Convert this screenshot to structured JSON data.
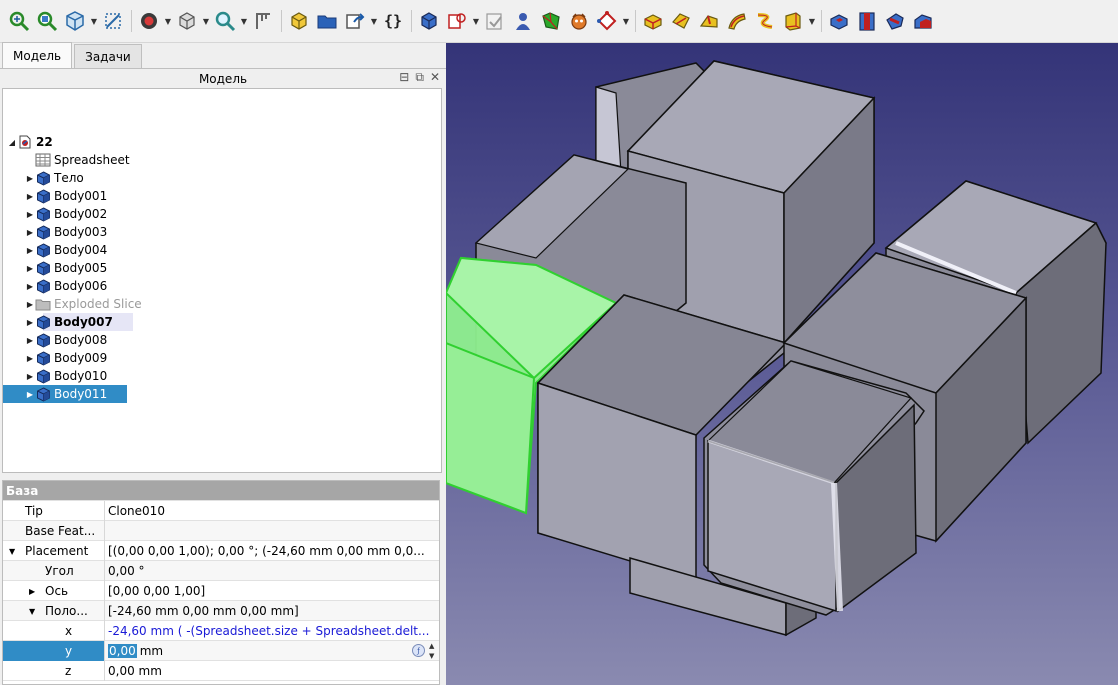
{
  "toolbar": {
    "icons": [
      "fit-all-icon",
      "zoom-selection-icon",
      "view-axonometric-icon",
      "view-measure-icon",
      "draw-style-icon",
      "bounding-box-icon",
      "view-zoom-icon",
      "measure-caliper-icon",
      "part-icon",
      "folder-icon",
      "link-icon",
      "macro-icon",
      "body-icon",
      "sketch-icon",
      "validate-sketch-icon",
      "map-sketch-icon",
      "face-icon",
      "creature-icon",
      "datum-plane-icon",
      "pad-icon",
      "revolution-icon",
      "additive-loft-icon",
      "additive-pipe-icon",
      "additive-helix-icon",
      "additive-box-icon",
      "pocket-icon",
      "hole-icon",
      "groove-icon",
      "subtractive-loft-icon"
    ],
    "brace_label": "{}"
  },
  "tabs": [
    {
      "label": "Модель",
      "active": true
    },
    {
      "label": "Задачи",
      "active": false
    }
  ],
  "panel_title": "Модель",
  "tree": {
    "root": "22",
    "items": [
      {
        "label": "Spreadsheet",
        "icon": "spreadsheet-icon",
        "bold": false,
        "dim": false
      },
      {
        "label": "Тело",
        "icon": "body-icon",
        "bold": false,
        "dim": false
      },
      {
        "label": "Body001",
        "icon": "body-icon",
        "bold": false,
        "dim": false
      },
      {
        "label": "Body002",
        "icon": "body-icon",
        "bold": false,
        "dim": false
      },
      {
        "label": "Body003",
        "icon": "body-icon",
        "bold": false,
        "dim": false
      },
      {
        "label": "Body004",
        "icon": "body-icon",
        "bold": false,
        "dim": false
      },
      {
        "label": "Body005",
        "icon": "body-icon",
        "bold": false,
        "dim": false
      },
      {
        "label": "Body006",
        "icon": "body-icon",
        "bold": false,
        "dim": false
      },
      {
        "label": "Exploded Slice",
        "icon": "folder-icon",
        "bold": false,
        "dim": true
      },
      {
        "label": "Body007",
        "icon": "body-icon",
        "bold": true,
        "dim": false
      },
      {
        "label": "Body008",
        "icon": "body-icon",
        "bold": false,
        "dim": false
      },
      {
        "label": "Body009",
        "icon": "body-icon",
        "bold": false,
        "dim": false
      },
      {
        "label": "Body010",
        "icon": "body-icon",
        "bold": false,
        "dim": false
      },
      {
        "label": "Body011",
        "icon": "body-icon",
        "bold": false,
        "dim": false
      }
    ]
  },
  "properties": {
    "group": "База",
    "rows": [
      {
        "name": "Tip",
        "value": "Clone010"
      },
      {
        "name": "Base Feat...",
        "value": ""
      },
      {
        "name": "Placement",
        "value": "[(0,00 0,00 1,00); 0,00 °; (-24,60 mm  0,00 mm  0,0..."
      },
      {
        "name": "Угол",
        "value": "0,00 °"
      },
      {
        "name": "Ось",
        "value": "[0,00 0,00 1,00]"
      },
      {
        "name": "Поло...",
        "value": "[-24,60 mm  0,00 mm  0,00 mm]"
      },
      {
        "name": "x",
        "value": "-24,60 mm  ( -(Spreadsheet.size + Spreadsheet.delt..."
      },
      {
        "name": "y",
        "value_edit": "0,00",
        "value_unit": "mm"
      },
      {
        "name": "z",
        "value": "0,00 mm"
      }
    ]
  },
  "colors": {
    "selection": "#308cc6",
    "highlight_green": "#8ff08f",
    "face_light": "#a8a8b6",
    "face_mid": "#8d8d9b",
    "face_dark": "#6d6d79"
  }
}
